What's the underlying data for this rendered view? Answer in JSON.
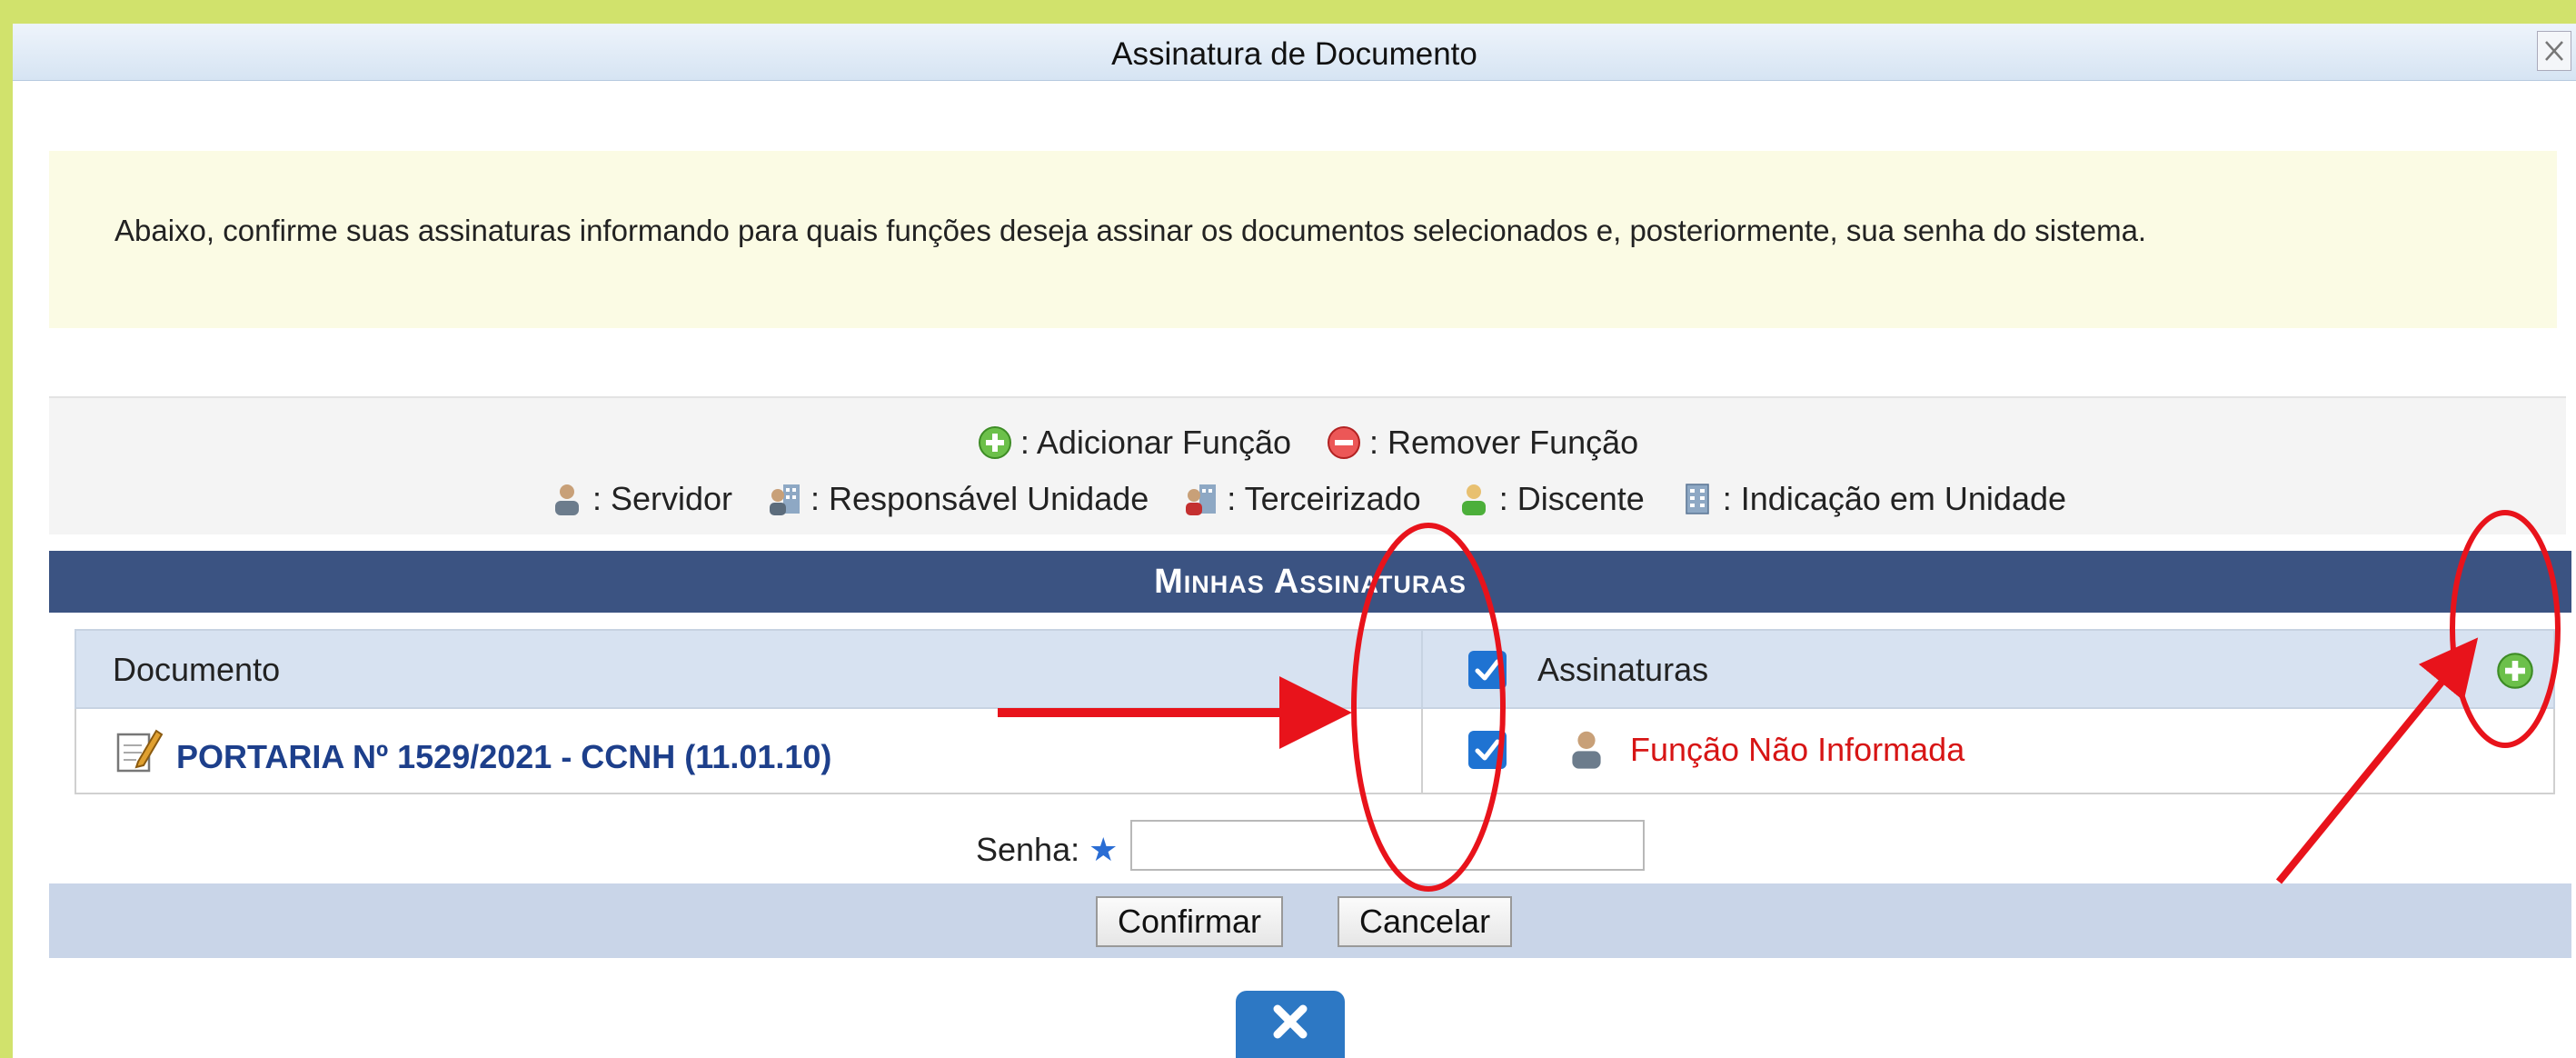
{
  "dialog": {
    "title": "Assinatura de Documento",
    "notice": "Abaixo, confirme suas assinaturas informando para quais funções deseja assinar os documentos selecionados e, posteriormente, sua senha do sistema."
  },
  "legend": {
    "row1": [
      {
        "icon": "green-plus-icon",
        "label": ": Adicionar Função"
      },
      {
        "icon": "red-minus-icon",
        "label": ": Remover Função"
      }
    ],
    "row2": [
      {
        "icon": "servidor-icon",
        "label": ": Servidor"
      },
      {
        "icon": "responsavel-unidade-icon",
        "label": ": Responsável Unidade"
      },
      {
        "icon": "terceirizado-icon",
        "label": ": Terceirizado"
      },
      {
        "icon": "discente-icon",
        "label": ": Discente"
      },
      {
        "icon": "indicacao-unidade-icon",
        "label": ": Indicação em Unidade"
      }
    ]
  },
  "section": {
    "title": "Minhas Assinaturas"
  },
  "table": {
    "col_documento": "Documento",
    "col_assinaturas": "Assinaturas",
    "rows": [
      {
        "documento": "PORTARIA Nº 1529/2021 - CCNH (11.01.10)",
        "funcao": "Função Não Informada",
        "checked": true
      }
    ]
  },
  "form": {
    "senha_label": "Senha:",
    "senha_required": "★",
    "senha_value": "",
    "confirm": "Confirmar",
    "cancel": "Cancelar"
  },
  "colors": {
    "header": "#3b5382",
    "link": "#1d3f8b",
    "funcao": "#d71515",
    "outer": "#d1e26c",
    "annotation": "#e8131b"
  }
}
